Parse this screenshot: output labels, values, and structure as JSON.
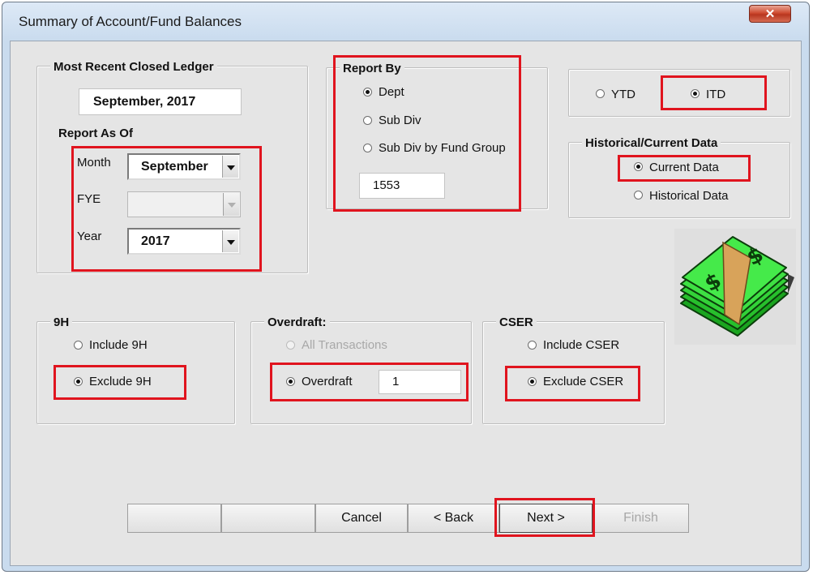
{
  "window": {
    "title": "Summary of Account/Fund Balances",
    "close_glyph": "✕"
  },
  "closed_ledger": {
    "title": "Most Recent Closed Ledger",
    "value": "September, 2017"
  },
  "report_as_of": {
    "title": "Report As Of",
    "month_label": "Month",
    "month_value": "September",
    "fye_label": "FYE",
    "fye_value": "",
    "year_label": "Year",
    "year_value": "2017"
  },
  "report_by": {
    "title": "Report By",
    "options": [
      "Dept",
      "Sub Div",
      "Sub Div by Fund Group"
    ],
    "selected": "Dept",
    "code": "1553"
  },
  "period": {
    "options": [
      "YTD",
      "ITD"
    ],
    "selected": "ITD"
  },
  "historical": {
    "title": "Historical/Current Data",
    "options": [
      "Current Data",
      "Historical Data"
    ],
    "selected": "Current Data"
  },
  "nine_h": {
    "title": "9H",
    "options": [
      "Include 9H",
      "Exclude 9H"
    ],
    "selected": "Exclude 9H"
  },
  "overdraft": {
    "title": "Overdraft:",
    "options": [
      "All Transactions",
      "Overdraft"
    ],
    "selected": "Overdraft",
    "value": "1"
  },
  "cser": {
    "title": "CSER",
    "options": [
      "Include CSER",
      "Exclude CSER"
    ],
    "selected": "Exclude CSER"
  },
  "buttons": {
    "blank1": "",
    "blank2": "",
    "cancel": "Cancel",
    "back": "< Back",
    "next": "Next >",
    "finish": "Finish"
  },
  "colors": {
    "highlight": "#e0141e",
    "dialog_bg": "#e5e5e5",
    "money_green": "#2ecc40"
  },
  "icons": {
    "money": "money-stack-icon",
    "close": "close-icon"
  }
}
